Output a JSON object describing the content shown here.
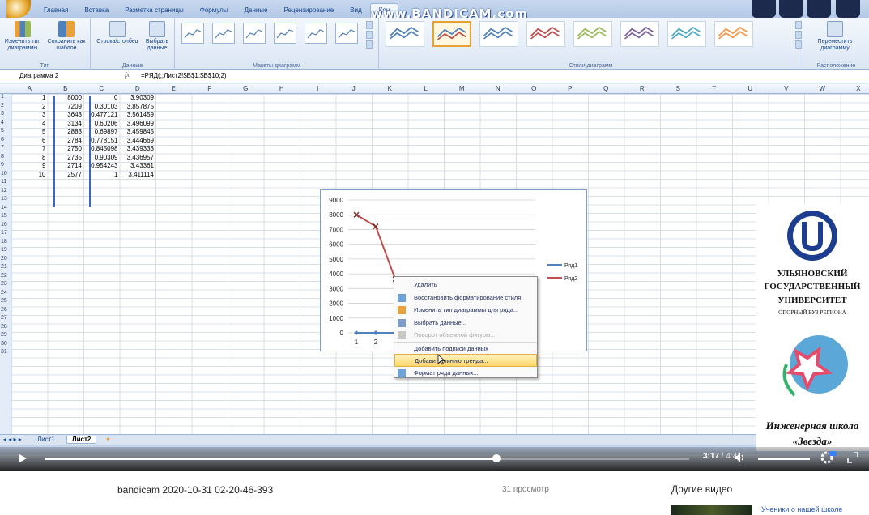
{
  "ribbon": {
    "tabs": [
      "Главная",
      "Вставка",
      "Разметка страницы",
      "Формулы",
      "Данные",
      "Рецензирование",
      "Вид",
      "Кон"
    ],
    "watermark": "www.BANDICAM.com",
    "btn_change_type": "Изменить тип диаграммы",
    "btn_save_template": "Сохранить как шаблон",
    "group_type": "Тип",
    "btn_row_col": "Строка/столбец",
    "btn_select_data": "Выбрать данные",
    "group_data": "Данные",
    "group_layouts": "Макеты диаграмм",
    "group_styles": "Стили диаграмм",
    "btn_move": "Переместить диаграмму",
    "group_location": "Расположение"
  },
  "formula_bar": {
    "name_box": "Диаграмма 2",
    "fx": "fx",
    "formula": "=РЯД(;;Лист2!$B$1:$B$10;2)"
  },
  "columns": [
    "A",
    "B",
    "C",
    "D",
    "E",
    "F",
    "G",
    "H",
    "I",
    "J",
    "K",
    "L",
    "M",
    "N",
    "O",
    "P",
    "Q",
    "R",
    "S",
    "T",
    "U",
    "V",
    "W",
    "X"
  ],
  "rows": [
    {
      "n": "1",
      "a": "1",
      "b": "8000",
      "c": "0",
      "d": "3,90309"
    },
    {
      "n": "2",
      "a": "2",
      "b": "7209",
      "c": "0,30103",
      "d": "3,857875"
    },
    {
      "n": "3",
      "a": "3",
      "b": "3643",
      "c": "0,477121",
      "d": "3,561459"
    },
    {
      "n": "4",
      "a": "4",
      "b": "3134",
      "c": "0,60206",
      "d": "3,496099"
    },
    {
      "n": "5",
      "a": "5",
      "b": "2883",
      "c": "0,69897",
      "d": "3,459845"
    },
    {
      "n": "6",
      "a": "6",
      "b": "2784",
      "c": "0,778151",
      "d": "3,444669"
    },
    {
      "n": "7",
      "a": "7",
      "b": "2750",
      "c": "0,845098",
      "d": "3,439333"
    },
    {
      "n": "8",
      "a": "8",
      "b": "2735",
      "c": "0,90309",
      "d": "3,436957"
    },
    {
      "n": "9",
      "a": "9",
      "b": "2714",
      "c": "0,954243",
      "d": "3,43361"
    },
    {
      "n": "10",
      "a": "10",
      "b": "2577",
      "c": "1",
      "d": "3,411114"
    }
  ],
  "empty_rows": [
    "11",
    "12",
    "13",
    "14",
    "15",
    "16",
    "17",
    "18",
    "19",
    "20",
    "21",
    "22",
    "23",
    "24",
    "25",
    "26",
    "27",
    "28",
    "29",
    "30",
    "31"
  ],
  "chart_data": {
    "type": "line",
    "x": [
      1,
      2,
      3
    ],
    "y_ticks": [
      "0",
      "1000",
      "2000",
      "3000",
      "4000",
      "5000",
      "6000",
      "7000",
      "8000",
      "9000"
    ],
    "x_ticks": [
      "1",
      "2",
      "3"
    ],
    "ylim": [
      0,
      9000
    ],
    "series": [
      {
        "name": "Ряд1",
        "color": "#4f81bd",
        "values": [
          0,
          0,
          0
        ]
      },
      {
        "name": "Ряд2",
        "color": "#c0504d",
        "values": [
          8000,
          7209,
          3643
        ]
      }
    ],
    "legend": "right"
  },
  "context_menu": [
    {
      "label": "Удалить",
      "icon": "",
      "disabled": false
    },
    {
      "label": "Восстановить форматирование стиля",
      "icon": "reset-icon",
      "disabled": false
    },
    {
      "label": "Изменить тип диаграммы для ряда...",
      "icon": "chart-icon",
      "disabled": false
    },
    {
      "label": "Выбрать данные...",
      "icon": "data-icon",
      "disabled": false
    },
    {
      "label": "Поворот объемной фигуры...",
      "icon": "rotate-icon",
      "disabled": true
    },
    {
      "label": "Добавить подписи данных",
      "icon": "",
      "disabled": false
    },
    {
      "label": "Добавить линию тренда...",
      "icon": "",
      "disabled": false,
      "highlighted": true
    },
    {
      "label": "Формат ряда данных...",
      "icon": "format-icon",
      "disabled": false
    }
  ],
  "sheets": {
    "tab1": "Лист1",
    "tab2": "Лист2"
  },
  "university": {
    "line1": "УЛЬЯНОВСКИЙ",
    "line2": "ГОСУДАРСТВЕННЫЙ",
    "line3": "УНИВЕРСИТЕТ",
    "line4": "ОПОРНЫЙ ВУЗ РЕГИОНА",
    "school1": "Инженерная школа",
    "school2": "«Звезда»"
  },
  "player": {
    "current": "3:17",
    "separator": " / ",
    "duration": "4:41",
    "progress_fraction": 0.7
  },
  "video_info": {
    "title": "bandicam 2020-10-31 02-20-46-393",
    "views": "31 просмотр",
    "other_videos": "Другие видео",
    "side_video_title": "Ученики о нашей школе"
  }
}
